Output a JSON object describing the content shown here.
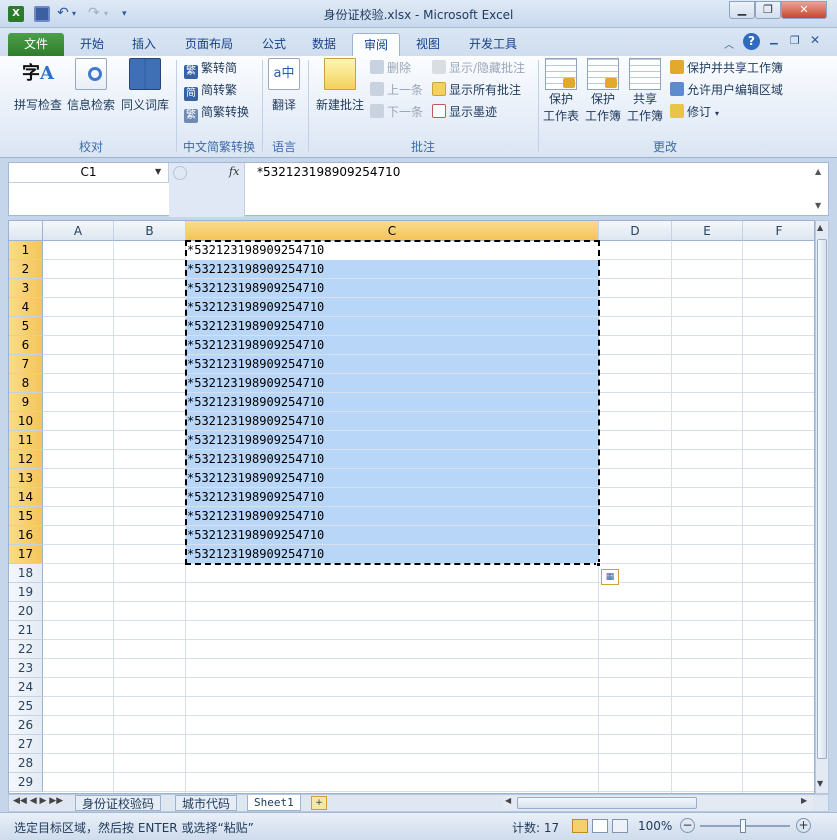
{
  "title": "身份证校验.xlsx  -  Microsoft Excel",
  "tabs": [
    "文件",
    "开始",
    "插入",
    "页面布局",
    "公式",
    "数据",
    "审阅",
    "视图",
    "开发工具"
  ],
  "ribbon": {
    "proofing": {
      "spell": "拼写检查",
      "research": "信息检索",
      "thesaurus": "同义词库",
      "label": "校对"
    },
    "chinese": {
      "to_simp": "繁转简",
      "to_trad": "简转繁",
      "convert": "简繁转换",
      "label": "中文简繁转换"
    },
    "language": {
      "translate": "翻译",
      "label": "语言"
    },
    "comments": {
      "new": "新建批注",
      "delete": "删除",
      "prev": "上一条",
      "next": "下一条",
      "show_hide": "显示/隐藏批注",
      "show_all": "显示所有批注",
      "show_ink": "显示墨迹",
      "label": "批注"
    },
    "changes": {
      "protect_sheet_1": "保护",
      "protect_sheet_2": "工作表",
      "protect_wb_1": "保护",
      "protect_wb_2": "工作簿",
      "share_wb_1": "共享",
      "share_wb_2": "工作簿",
      "protect_share": "保护并共享工作簿",
      "allow_edit": "允许用户编辑区域",
      "track": "修订",
      "label": "更改"
    }
  },
  "formula_bar": {
    "name_box": "C1",
    "fx": "fx",
    "content": "*532123198909254710"
  },
  "columns": [
    "A",
    "B",
    "C",
    "D",
    "E",
    "F"
  ],
  "rows": [
    "1",
    "2",
    "3",
    "4",
    "5",
    "6",
    "7",
    "8",
    "9",
    "10",
    "11",
    "12",
    "13",
    "14",
    "15",
    "16",
    "17",
    "18",
    "19",
    "20",
    "21",
    "22",
    "23",
    "24",
    "25",
    "26",
    "27",
    "28",
    "29"
  ],
  "cell_values": [
    "*532123198909254710",
    "*532123198909254710",
    "*532123198909254710",
    "*532123198909254710",
    "*532123198909254710",
    "*532123198909254710",
    "*532123198909254710",
    "*532123198909254710",
    "*532123198909254710",
    "*532123198909254710",
    "*532123198909254710",
    "*532123198909254710",
    "*532123198909254710",
    "*532123198909254710",
    "*532123198909254710",
    "*532123198909254710",
    "*532123198909254710"
  ],
  "sheets": [
    "身份证校验码",
    "城市代码",
    "Sheet1"
  ],
  "status": {
    "message": "选定目标区域，然后按 ENTER 或选择“粘贴”",
    "count": "计数: 17",
    "zoom": "100%"
  },
  "colors": {
    "selection": "#b8d6f8",
    "file_tab": "#3a8c36",
    "header_selected": "#f7cf6e"
  }
}
